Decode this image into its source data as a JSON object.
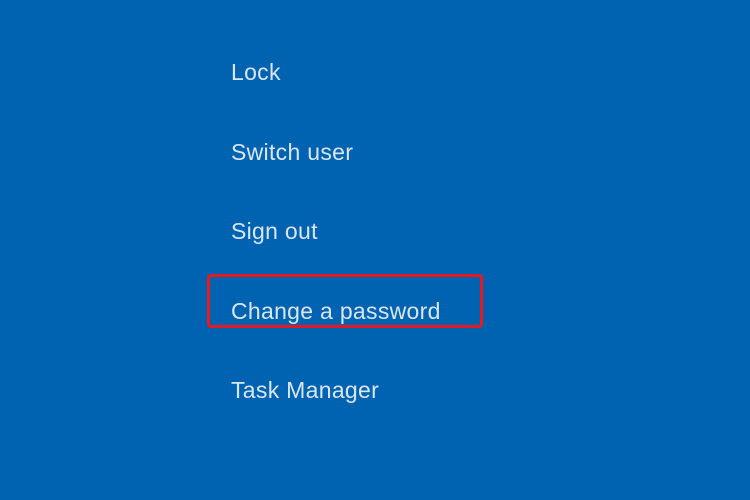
{
  "security_menu": {
    "items": [
      {
        "label": "Lock"
      },
      {
        "label": "Switch user"
      },
      {
        "label": "Sign out"
      },
      {
        "label": "Change a password"
      },
      {
        "label": "Task Manager"
      }
    ]
  }
}
